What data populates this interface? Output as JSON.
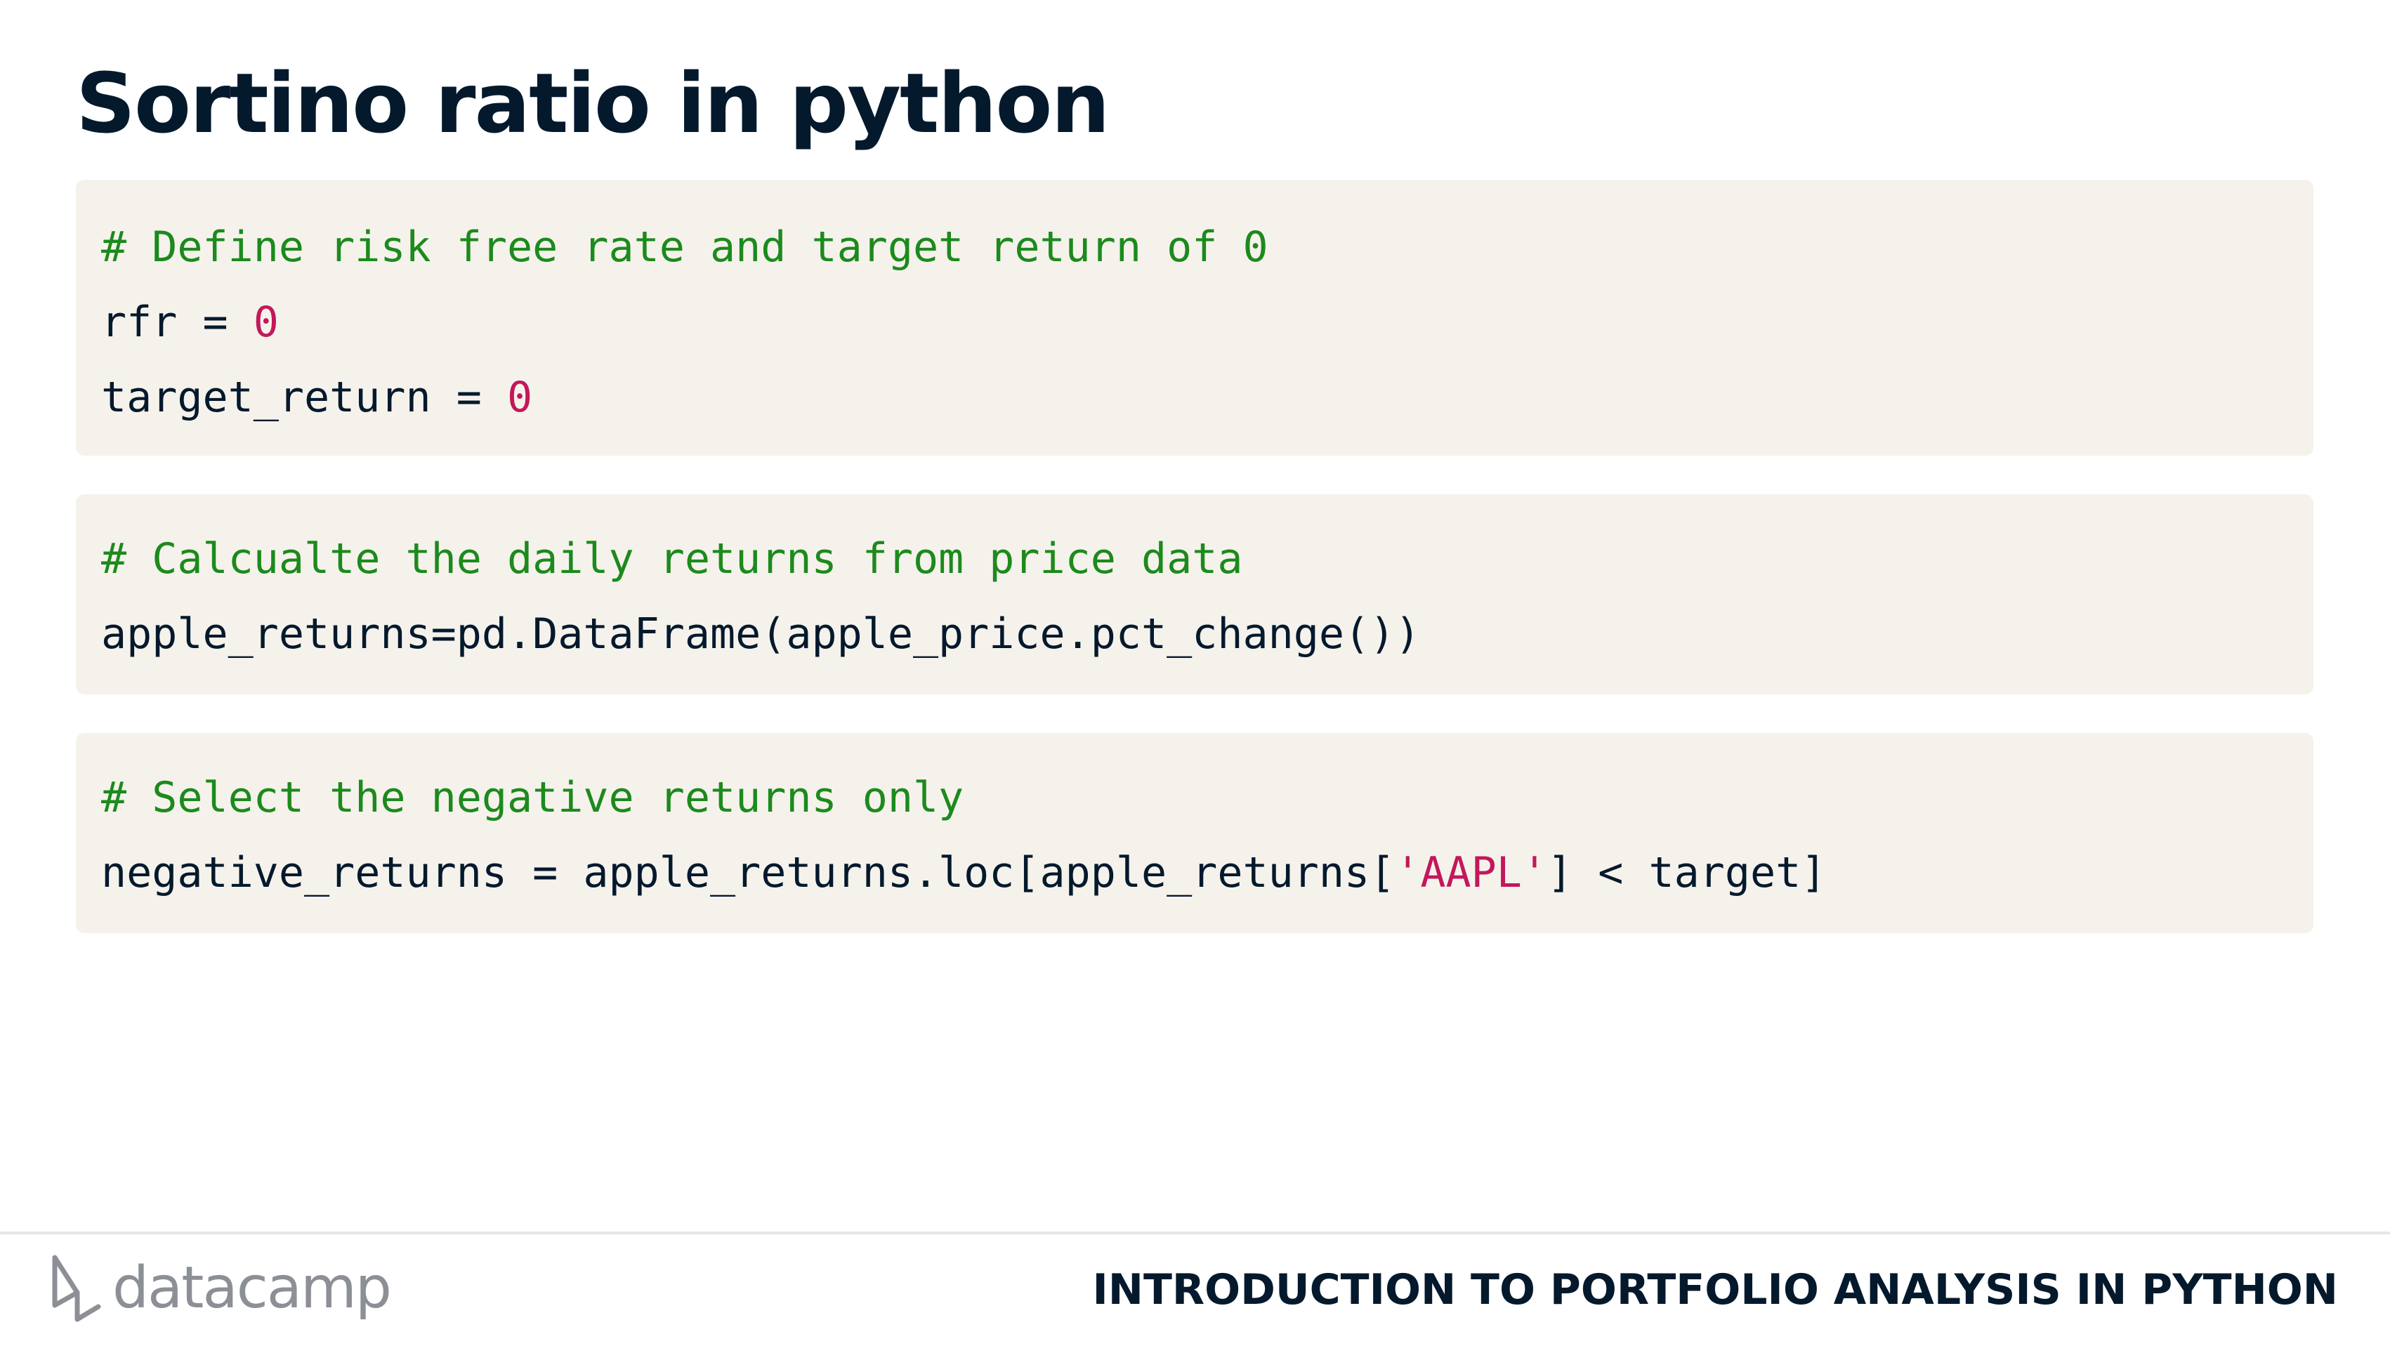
{
  "slide": {
    "title": "Sortino ratio in python"
  },
  "code_blocks": [
    {
      "lines": [
        {
          "comment": "# Define risk free rate and target return of 0"
        },
        {
          "pre": "rfr = ",
          "num": "0"
        },
        {
          "pre": "target_return = ",
          "num": "0"
        }
      ]
    },
    {
      "lines": [
        {
          "comment": "# Calcualte the daily returns from price data"
        },
        {
          "code": "apple_returns=pd.DataFrame(apple_price.pct_change())"
        }
      ]
    },
    {
      "lines": [
        {
          "comment": "# Select the negative returns only"
        },
        {
          "pre": "negative_returns = apple_returns.loc[apple_returns[",
          "str": "'AAPL'",
          "post": "] < target]"
        }
      ]
    }
  ],
  "footer": {
    "brand": "datacamp",
    "course_title": "INTRODUCTION TO PORTFOLIO ANALYSIS IN PYTHON"
  },
  "colors": {
    "title": "#05192d",
    "code_bg": "#f5f2ec",
    "comment": "#1c8a1c",
    "literal": "#c2185b",
    "brand_gray": "#8c9096"
  },
  "icons": {
    "brand_logo": "datacamp-logo-icon"
  }
}
